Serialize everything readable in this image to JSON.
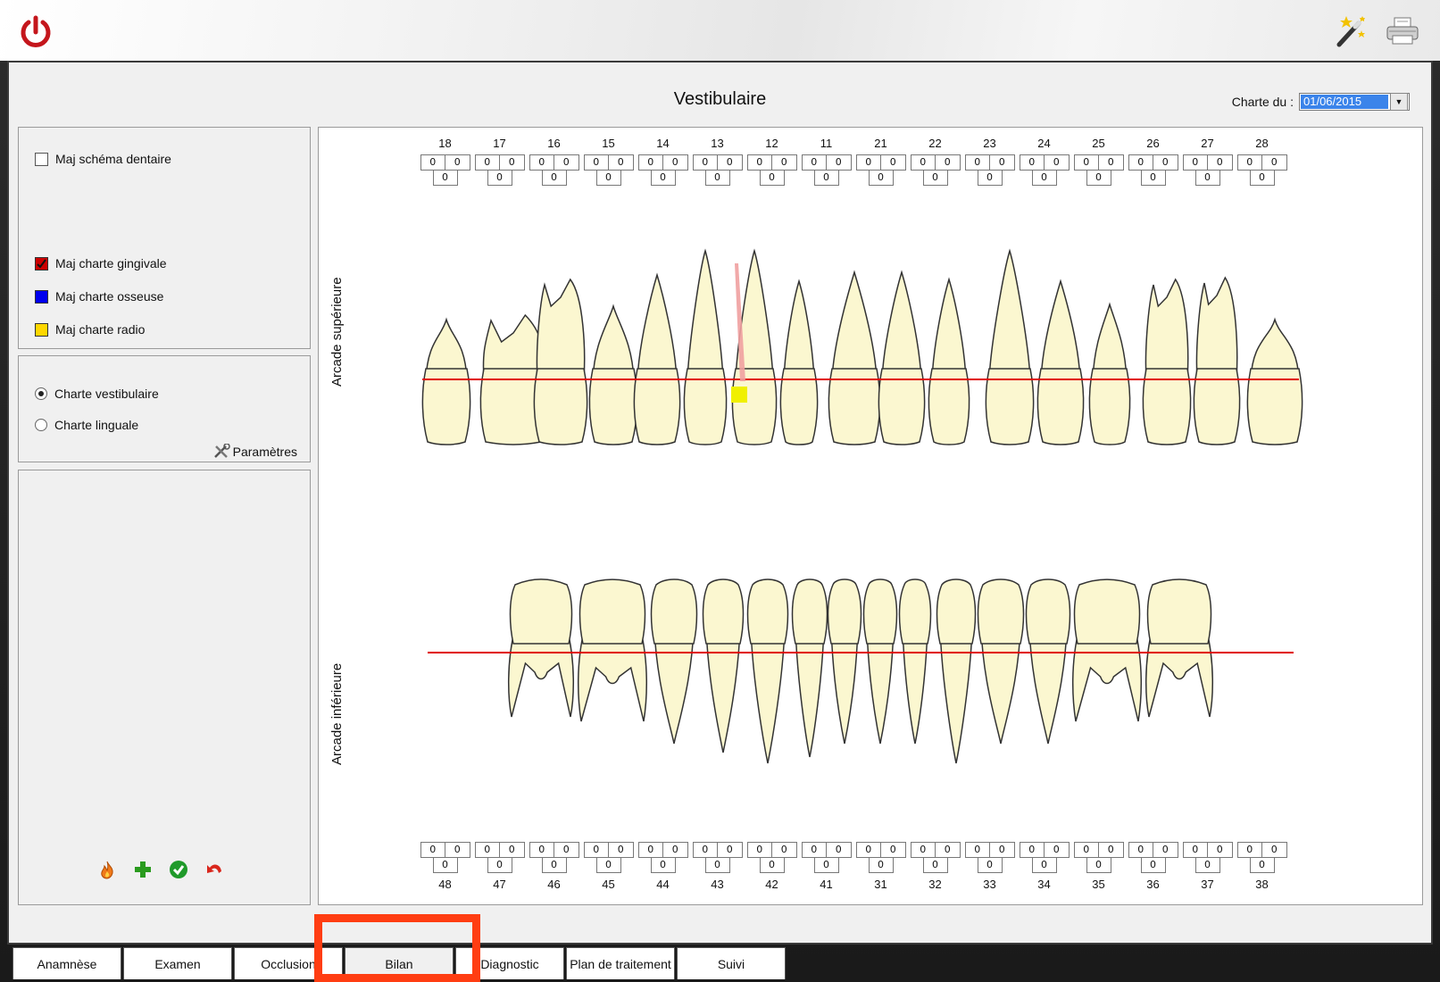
{
  "window": {
    "icons": [
      "power-icon",
      "magic-wand-icon",
      "printer-icon"
    ]
  },
  "header": {
    "title": "Vestibulaire",
    "charte_du_label": "Charte du :",
    "date_value": "01/06/2015"
  },
  "left_panel": {
    "maj_schema": "Maj schéma dentaire",
    "maj_gingivale": "Maj charte gingivale",
    "maj_osseuse": "Maj charte osseuse",
    "maj_radio": "Maj charte radio",
    "charte_vestibulaire": "Charte vestibulaire",
    "charte_linguale": "Charte linguale",
    "parametres": "Paramètres",
    "colors": {
      "gingivale": "#cc0000",
      "osseuse": "#0000ee",
      "radio": "#ffd700"
    }
  },
  "chart": {
    "arcade_sup": "Arcade supérieure",
    "arcade_inf": "Arcade inférieure",
    "upper_teeth": [
      "18",
      "17",
      "16",
      "15",
      "14",
      "13",
      "12",
      "11",
      "21",
      "22",
      "23",
      "24",
      "25",
      "26",
      "27",
      "28"
    ],
    "lower_teeth": [
      "48",
      "47",
      "46",
      "45",
      "44",
      "43",
      "42",
      "41",
      "31",
      "32",
      "33",
      "34",
      "35",
      "36",
      "37",
      "38"
    ],
    "values_upper": [
      [
        "0",
        "0",
        "0"
      ],
      [
        "0",
        "0",
        "0"
      ],
      [
        "0",
        "0",
        "0"
      ],
      [
        "0",
        "0",
        "0"
      ],
      [
        "0",
        "0",
        "0"
      ],
      [
        "0",
        "0",
        "0"
      ],
      [
        "0",
        "0",
        "0"
      ],
      [
        "0",
        "0",
        "0"
      ],
      [
        "0",
        "0",
        "0"
      ],
      [
        "0",
        "0",
        "0"
      ],
      [
        "0",
        "0",
        "0"
      ],
      [
        "0",
        "0",
        "0"
      ],
      [
        "0",
        "0",
        "0"
      ],
      [
        "0",
        "0",
        "0"
      ],
      [
        "0",
        "0",
        "0"
      ],
      [
        "0",
        "0",
        "0"
      ]
    ],
    "values_lower": [
      [
        "0",
        "0",
        "0"
      ],
      [
        "0",
        "0",
        "0"
      ],
      [
        "0",
        "0",
        "0"
      ],
      [
        "0",
        "0",
        "0"
      ],
      [
        "0",
        "0",
        "0"
      ],
      [
        "0",
        "0",
        "0"
      ],
      [
        "0",
        "0",
        "0"
      ],
      [
        "0",
        "0",
        "0"
      ],
      [
        "0",
        "0",
        "0"
      ],
      [
        "0",
        "0",
        "0"
      ],
      [
        "0",
        "0",
        "0"
      ],
      [
        "0",
        "0",
        "0"
      ],
      [
        "0",
        "0",
        "0"
      ],
      [
        "0",
        "0",
        "0"
      ],
      [
        "0",
        "0",
        "0"
      ],
      [
        "0",
        "0",
        "0"
      ]
    ],
    "colors": {
      "tooth_fill": "#fbf7d0",
      "line": "#e00000",
      "radio_marker": "#f0f000",
      "root_mark": "#f0a0a0"
    }
  },
  "tabs": [
    {
      "label": "Anamnèse"
    },
    {
      "label": "Examen"
    },
    {
      "label": "Occlusion"
    },
    {
      "label": "Bilan"
    },
    {
      "label": "Diagnostic"
    },
    {
      "label": "Plan de traitement"
    },
    {
      "label": "Suivi"
    }
  ],
  "highlight_color": "#ff3d12"
}
